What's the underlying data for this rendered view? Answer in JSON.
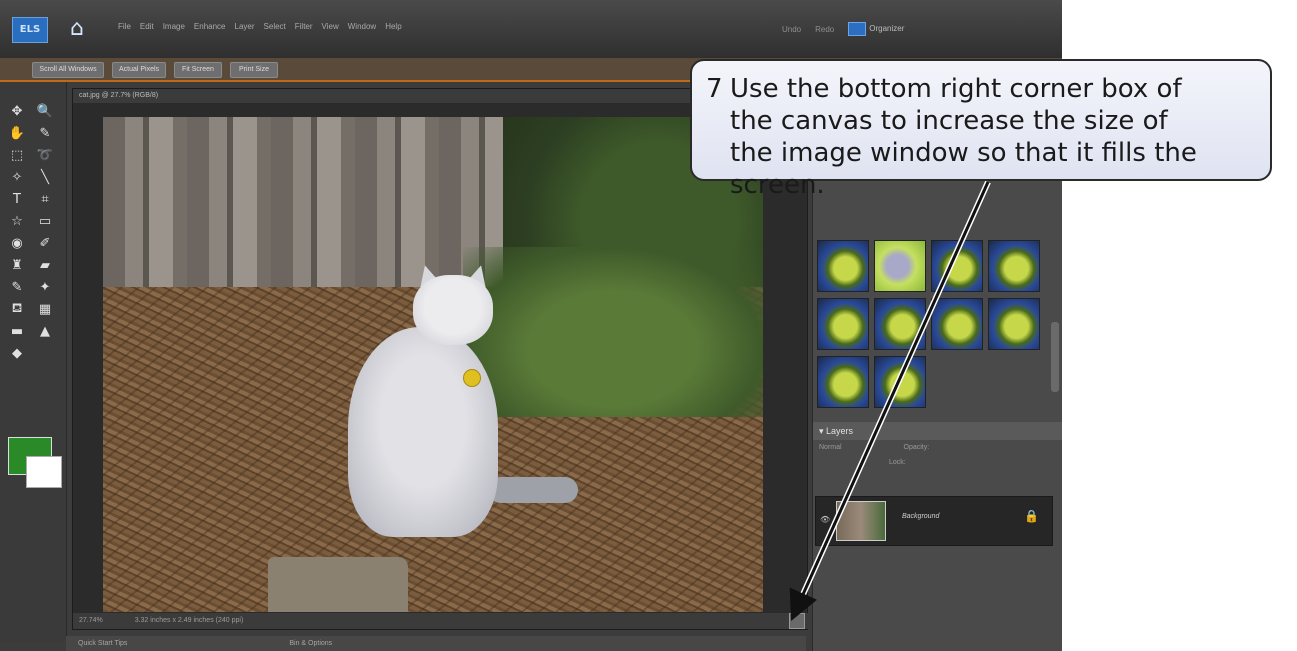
{
  "app": {
    "logo": "ELS",
    "menus": [
      "File",
      "Edit",
      "Image",
      "Enhance",
      "Layer",
      "Select",
      "Filter",
      "View",
      "Window",
      "Help"
    ],
    "right_menu": [
      "Undo",
      "Redo",
      "Organizer"
    ]
  },
  "options_bar": [
    "Scroll All Windows",
    "Actual Pixels",
    "Fit Screen",
    "Print Size"
  ],
  "document": {
    "title": "cat.jpg @ 27.7% (RGB/8)",
    "zoom": "27.74%",
    "status": "3.32 inches x 2.49 inches (240 ppi)"
  },
  "bottombar": {
    "left": "Quick Start Tips",
    "right": "Bin & Options"
  },
  "panel": {
    "layers_title": "Layers",
    "blend_mode": "Normal",
    "opacity_label": "Opacity:",
    "lock_label": "Lock:",
    "layer_name": "Background"
  },
  "callout": {
    "step": "7",
    "line1": "Use the bottom right corner box of",
    "line2": "the canvas to increase the size of",
    "line3": "the image window so that it fills the",
    "line4": "screen."
  },
  "colors": {
    "accent": "#c06a1a",
    "foreground_swatch": "#2a8a28",
    "background_swatch": "#ffffff"
  }
}
